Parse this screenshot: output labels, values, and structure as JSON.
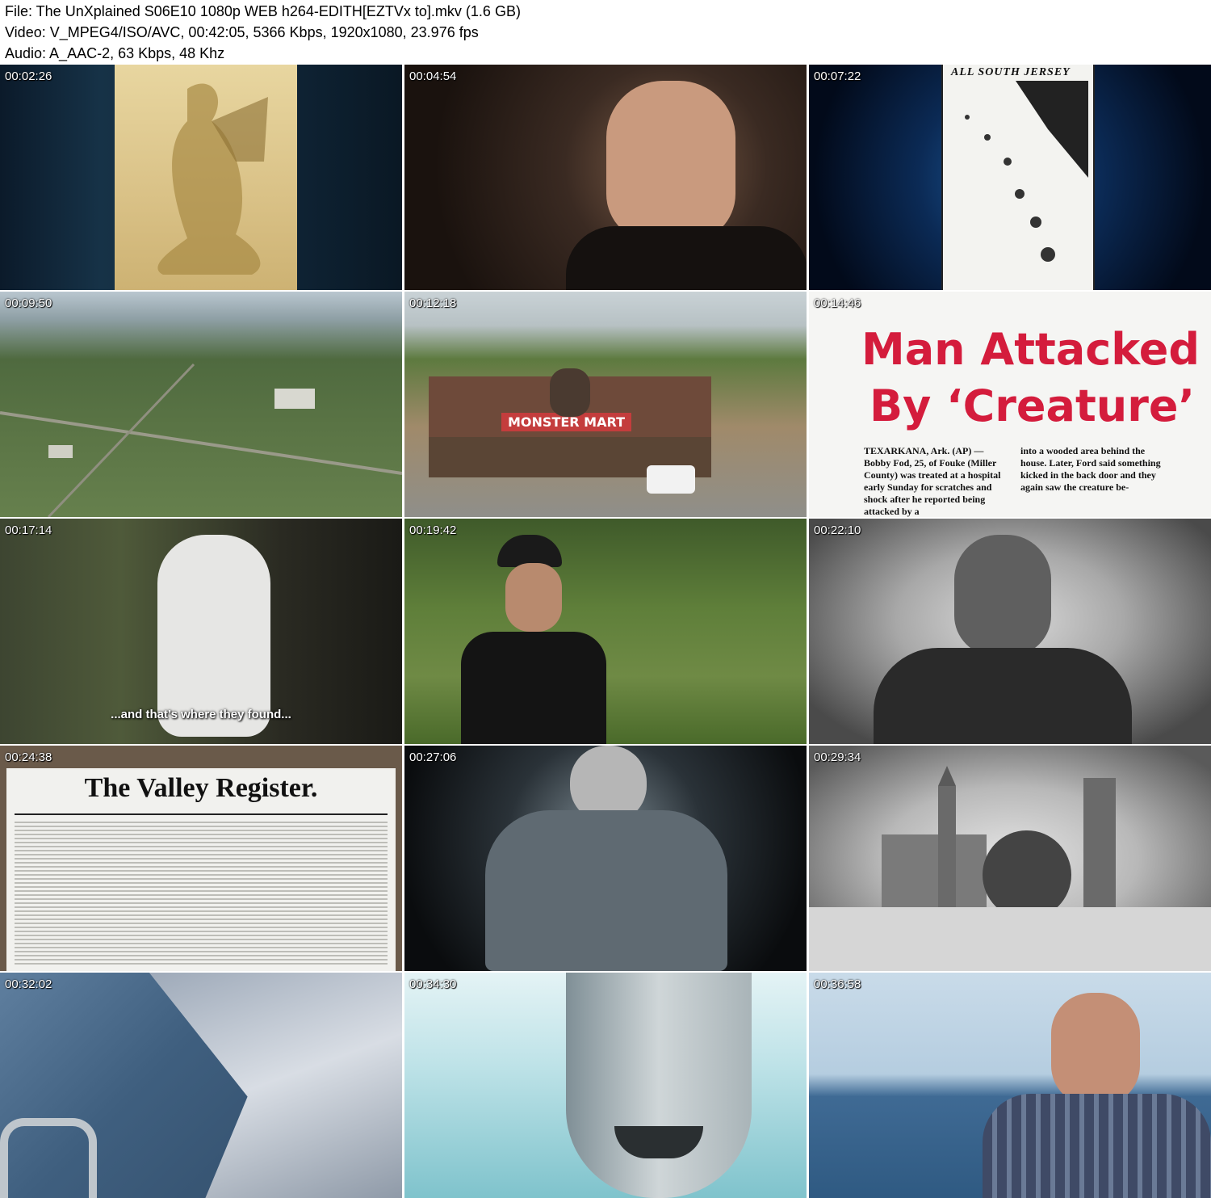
{
  "header": {
    "file_line": "File: The UnXplained S06E10 1080p WEB h264-EDITH[EZTVx to].mkv (1.6 GB)",
    "video_line": "Video: V_MPEG4/ISO/AVC, 00:42:05, 5366 Kbps, 1920x1080, 23.976 fps",
    "audio_line": "Audio: A_AAC-2, 63 Kbps, 48 Khz"
  },
  "thumbnails": [
    {
      "timestamp": "00:02:26"
    },
    {
      "timestamp": "00:04:54"
    },
    {
      "timestamp": "00:07:22",
      "paper_heading": "ALL SOUTH JERSEY"
    },
    {
      "timestamp": "00:09:50"
    },
    {
      "timestamp": "00:12:18",
      "sign": "MONSTER MART"
    },
    {
      "timestamp": "00:14:46",
      "headline_line1": "Man Attacked",
      "headline_line2": "By ‘Creature’",
      "article_left": "TEXARKANA, Ark. (AP) — Bobby Fod, 25, of Fouke (Miller County) was treated at a hospital early Sunday for scratches and shock after he reported being attacked by a",
      "article_right": "into a wooded area behind the house. Later, Ford said something kicked in the back door and they again saw the creature be-"
    },
    {
      "timestamp": "00:17:14",
      "subtitle": "...and that’s where they found..."
    },
    {
      "timestamp": "00:19:42"
    },
    {
      "timestamp": "00:22:10"
    },
    {
      "timestamp": "00:24:38",
      "masthead": "The Valley Register."
    },
    {
      "timestamp": "00:27:06"
    },
    {
      "timestamp": "00:29:34"
    },
    {
      "timestamp": "00:32:02"
    },
    {
      "timestamp": "00:34:30"
    },
    {
      "timestamp": "00:36:58"
    }
  ]
}
